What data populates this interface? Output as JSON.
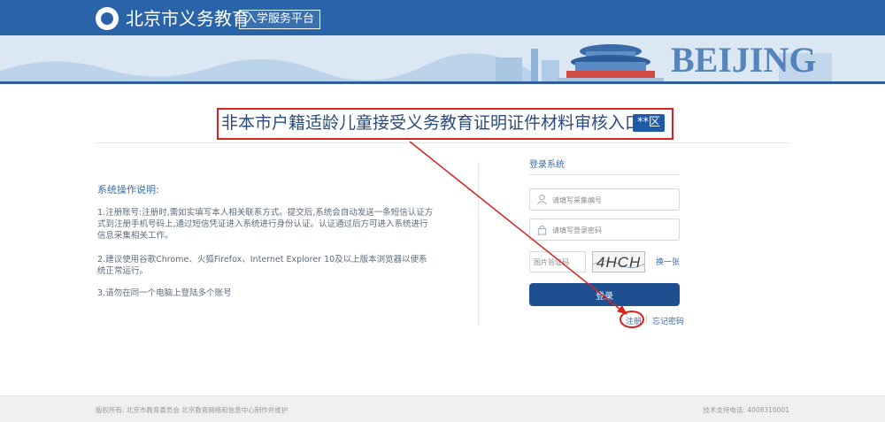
{
  "header": {
    "brand_title": "北京市义务教育",
    "brand_badge": "入学服务平台",
    "banner_text": "BEIJING"
  },
  "page": {
    "title": "非本市户籍适龄儿童接受义务教育证明证件材料审核入口",
    "district_badge": "**区"
  },
  "instructions": {
    "heading": "系统操作说明:",
    "items": [
      "1.注册账号:注册时,需如实填写本人相关联系方式。提交后,系统会自动发送一条短信认证方式到注册手机号码上,通过短信凭证进入系统进行身份认证。认证通过后方可进入系统进行信息采集相关工作。",
      "2.建议使用谷歌Chrome、火狐Firefox、Internet Explorer 10及以上版本浏览器以便系统正常运行。",
      "3.请勿在同一个电脑上登陆多个账号"
    ]
  },
  "login": {
    "title": "登录系统",
    "username_placeholder": "请填写采集编号",
    "password_placeholder": "请填写登录密码",
    "captcha_placeholder": "图片验证码",
    "captcha_text": "4HCH",
    "refresh_label": "换一张",
    "submit_label": "登录",
    "register_label": "注册",
    "separator": "|",
    "forgot_label": "忘记密码"
  },
  "footer": {
    "left": "版权所有: 北京市教育委员会 北京教育网络和信息中心制作并维护",
    "right": "技术支持电话: 4008310001"
  },
  "colors": {
    "primary": "#1d4f91",
    "header_blue": "#2a64a8",
    "annotation_red": "#d8231f"
  }
}
